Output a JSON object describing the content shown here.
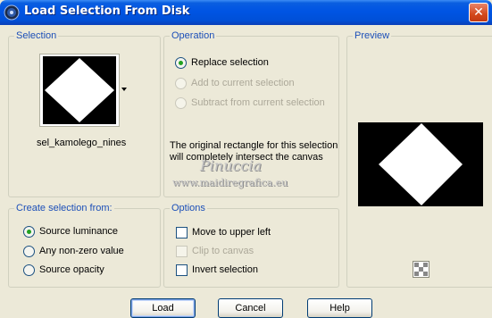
{
  "window": {
    "title": "Load Selection From Disk",
    "close_glyph": "✕",
    "icon": "psp-app-icon"
  },
  "selection_group": {
    "label": "Selection",
    "file_name": "sel_kamolego_nines",
    "thumbnail": "white-diamond-on-black"
  },
  "operation_group": {
    "label": "Operation",
    "options": [
      {
        "label": "Replace selection",
        "checked": true,
        "enabled": true
      },
      {
        "label": "Add to current selection",
        "checked": false,
        "enabled": false
      },
      {
        "label": "Subtract from current selection",
        "checked": false,
        "enabled": false
      }
    ],
    "info_text": "The original rectangle for this selection will completely intersect the canvas",
    "watermark_name": "Pinuccia",
    "watermark_url": "www.maidiregrafica.eu"
  },
  "preview_group": {
    "label": "Preview",
    "image": "white-diamond-on-black",
    "zoom_icon": "checkerboard-icon"
  },
  "create_from_group": {
    "label": "Create selection from:",
    "options": [
      {
        "label": "Source luminance",
        "checked": true
      },
      {
        "label": "Any non-zero value",
        "checked": false
      },
      {
        "label": "Source opacity",
        "checked": false
      }
    ]
  },
  "options_group": {
    "label": "Options",
    "items": [
      {
        "label": "Move to upper left",
        "checked": false,
        "enabled": true
      },
      {
        "label": "Clip to canvas",
        "checked": false,
        "enabled": false
      },
      {
        "label": "Invert selection",
        "checked": false,
        "enabled": true
      }
    ]
  },
  "buttons": {
    "load": "Load",
    "cancel": "Cancel",
    "help": "Help"
  },
  "colors": {
    "titlebar": "#0054e3",
    "dialog_bg": "#ece9d8",
    "group_label": "#1c4fb8",
    "radio_dot": "#21a121",
    "close_button": "#d3491b"
  }
}
